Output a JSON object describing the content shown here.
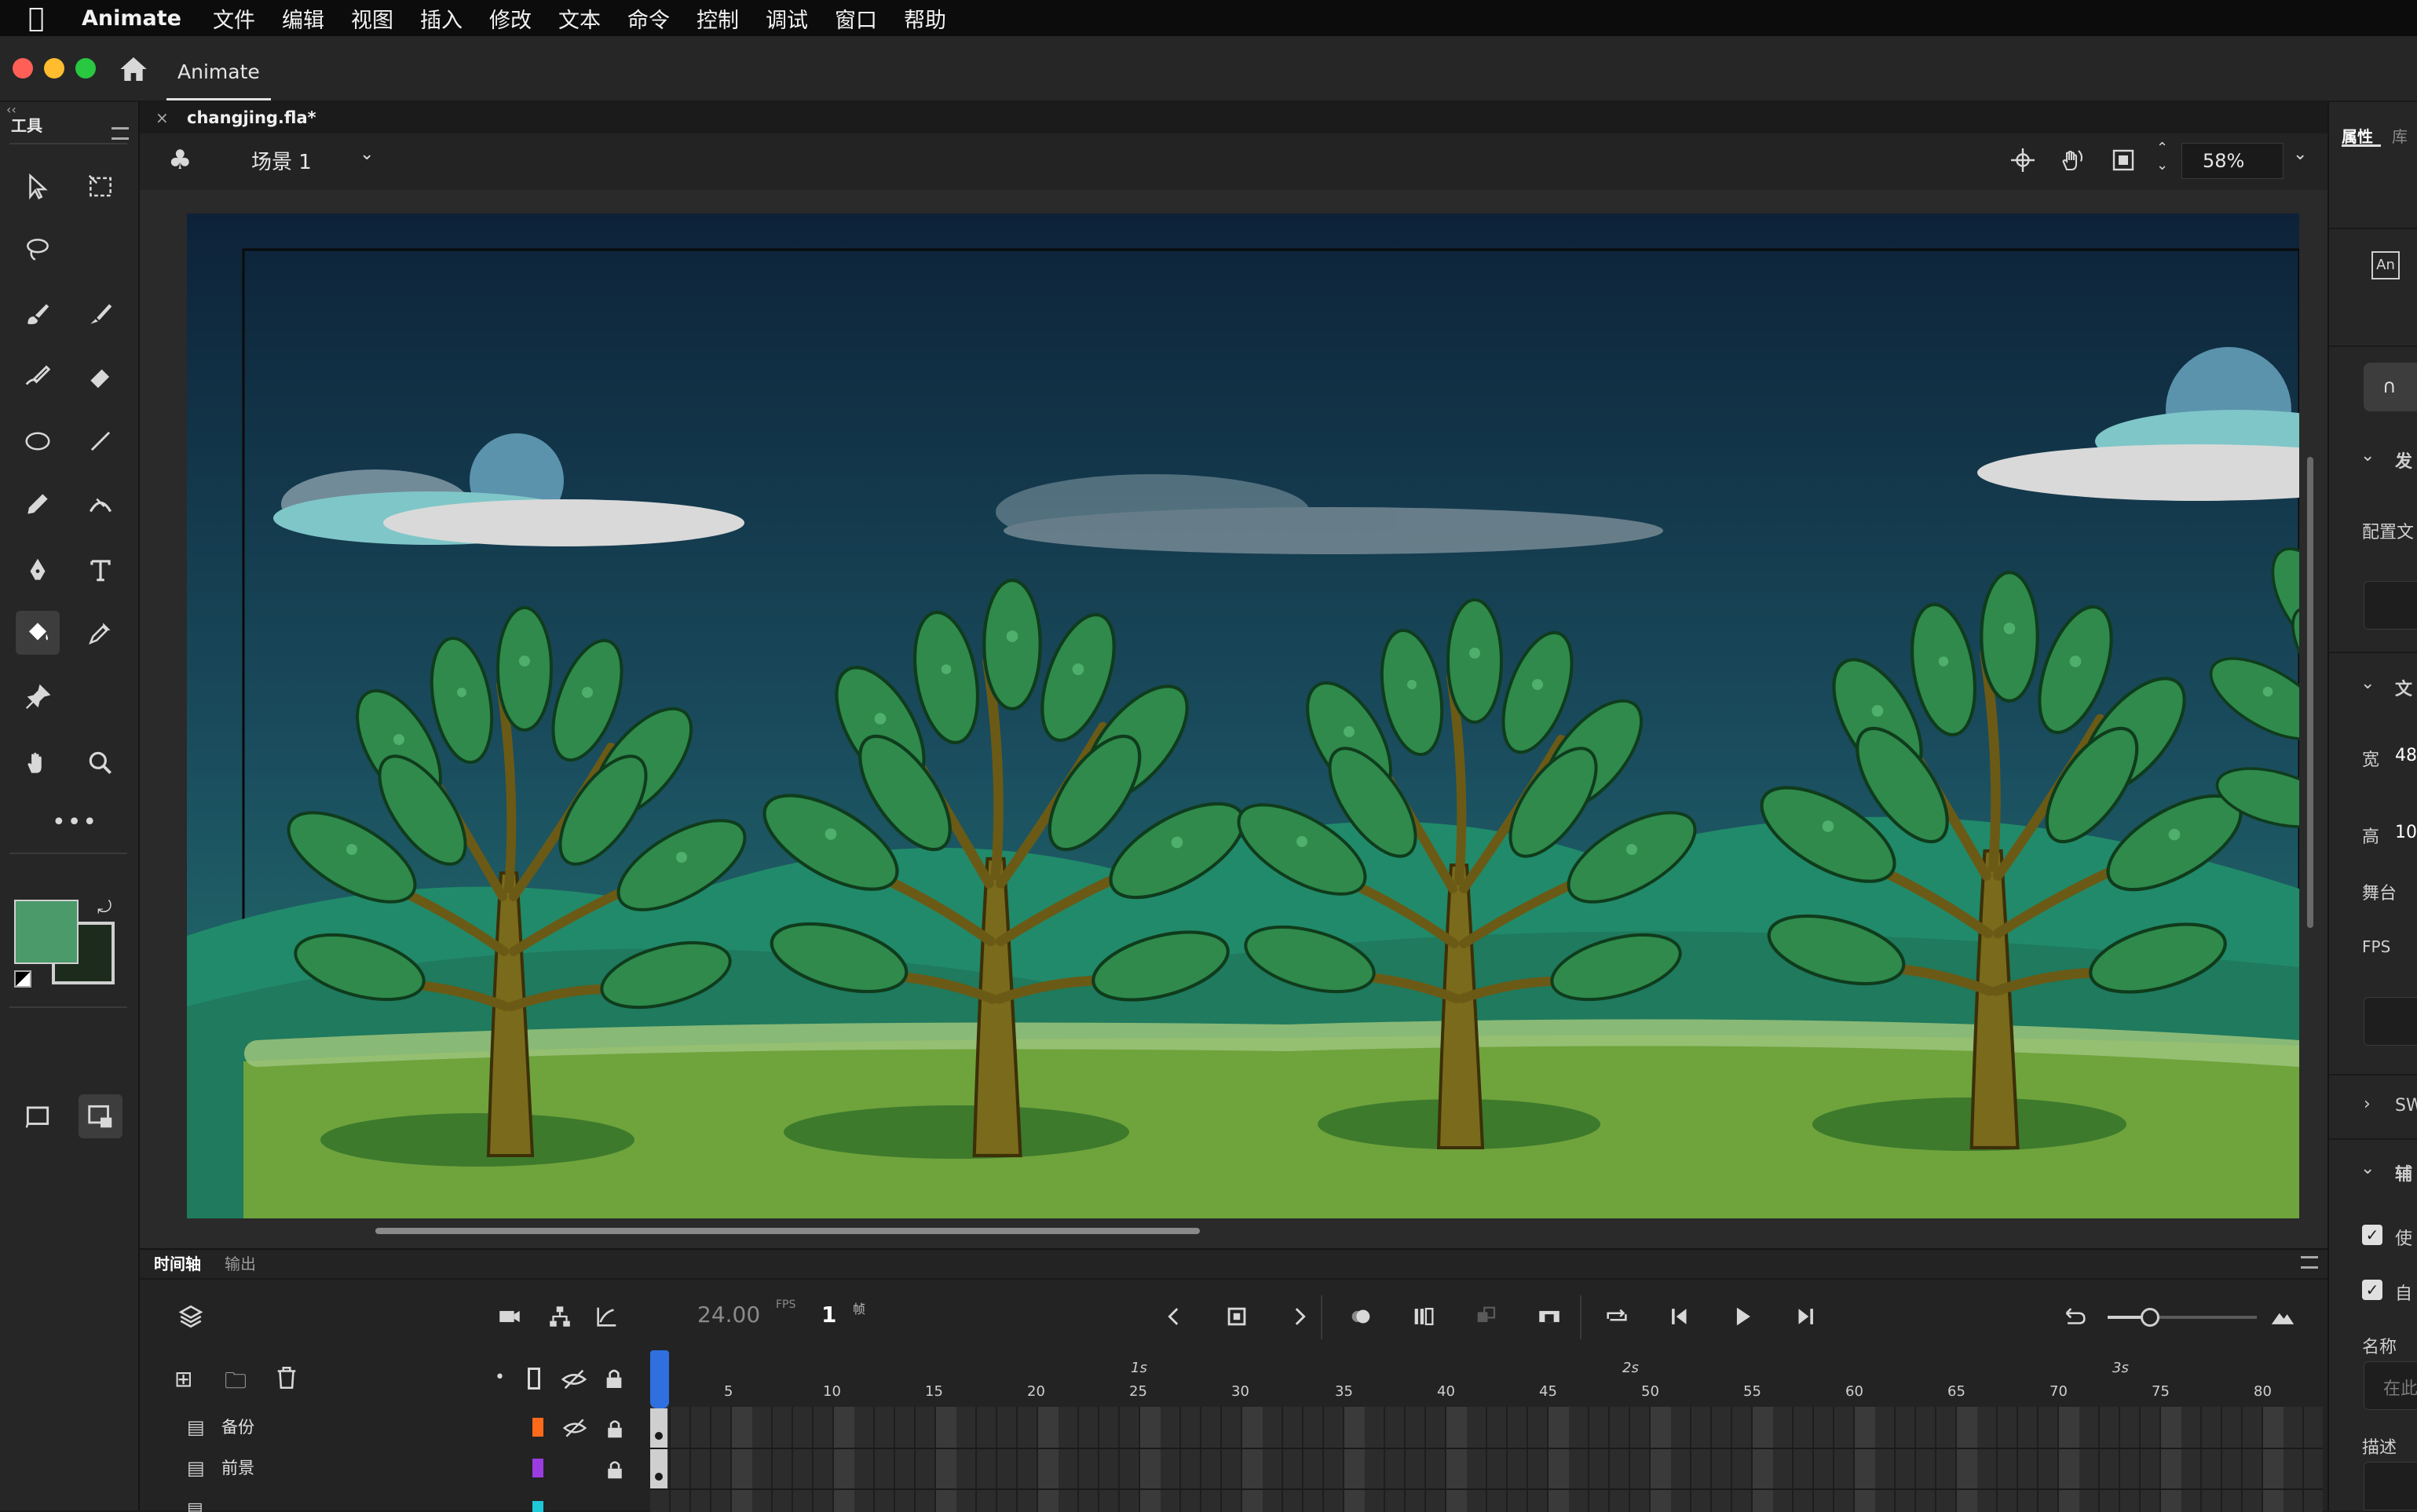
{
  "menubar": {
    "app_name": "Animate",
    "items": [
      "文件",
      "编辑",
      "视图",
      "插入",
      "修改",
      "文本",
      "命令",
      "控制",
      "调试",
      "窗口",
      "帮助"
    ]
  },
  "titlebar": {
    "tab_label": "Animate"
  },
  "tools": {
    "header": "工具",
    "fill_color": "#4a9a6a"
  },
  "document": {
    "tab_name": "changjing.fla*",
    "scene_label": "场景 1",
    "zoom": "58%"
  },
  "timeline": {
    "tabs": [
      "时间轴",
      "输出"
    ],
    "fps_value": "24.00",
    "fps_unit": "FPS",
    "frame_value": "1",
    "frame_unit": "帧",
    "seconds": [
      "1s",
      "2s",
      "3s"
    ],
    "frame_numbers": [
      "5",
      "10",
      "15",
      "20",
      "25",
      "30",
      "35",
      "40",
      "45",
      "50",
      "55",
      "60",
      "65",
      "70",
      "75",
      "80"
    ],
    "layers": [
      {
        "name": "备份",
        "color": "#ff6a1a"
      },
      {
        "name": "前景",
        "color": "#9b3ce0"
      }
    ]
  },
  "properties": {
    "tabs": [
      "属性",
      "库"
    ],
    "doc_icon": "An",
    "section_publish": "发",
    "config_label": "配置文",
    "section_doc": "文",
    "width_label": "宽",
    "width_value": "48",
    "height_label": "高",
    "height_value": "10",
    "stage_label": "舞台",
    "fps_label": "FPS",
    "swf_label": "SW",
    "aux_label": "辅",
    "checkbox1": "使",
    "checkbox2": "自",
    "name_label": "名称",
    "name_placeholder": "在此",
    "desc_label": "描述"
  }
}
